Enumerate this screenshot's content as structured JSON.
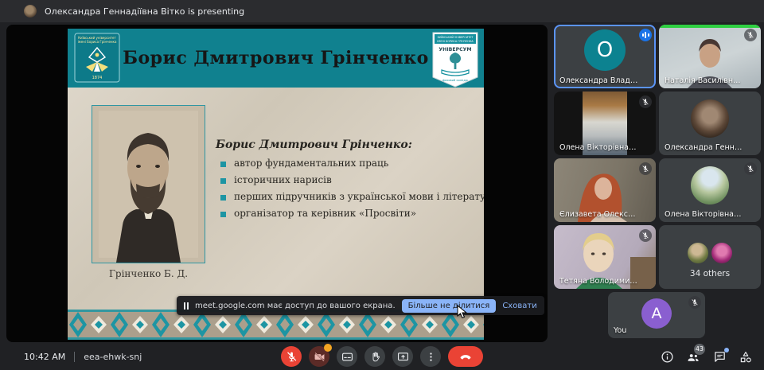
{
  "top_bar": {
    "presenting_text": "Олександра Геннадіївна Вітко is presenting"
  },
  "slide": {
    "title": "Борис Дмитрович Грінченко",
    "intro_heading": "Борис Дмитрович Грінченко:",
    "bullets": [
      "автор фундаментальних праць",
      "історичних нарисів",
      "перших підручників з української мови і літератури",
      "організатор та керівник «Просвіти»"
    ],
    "portrait_caption": "Грінченко Б. Д.",
    "left_logo": {
      "line1": "Київський університет",
      "line2": "імені Бориса Грінченка",
      "year": "1874"
    },
    "right_logo": {
      "line1": "КИЇВСЬКИЙ УНІВЕРСИТЕТ",
      "line2": "ІМЕНІ БОРИСА ГРІНЧЕНКА",
      "name": "УНІВЕРСУМ",
      "subtitle": "фаховий коледж"
    }
  },
  "share_notice": {
    "text": "meet.google.com має доступ до вашого екрана.",
    "stop_sharing_label": "Більше не ділитися",
    "hide_label": "Сховати"
  },
  "participants": [
    {
      "name": "Олександра Владиславівна ...",
      "initial": "О"
    },
    {
      "name": "Наталія Василівна Розінкович"
    },
    {
      "name": "Олена Вікторівна Груздьова"
    },
    {
      "name": "Олександра Геннадіївна Вітко"
    },
    {
      "name": "Єлизавета Олександрівна Мі..."
    },
    {
      "name": "Олена Вікторівна Груздьова"
    },
    {
      "name": "Тетяна Володимирівна Ловей..."
    },
    {
      "name": "34 others"
    },
    {
      "name": "You",
      "initial": "A"
    }
  ],
  "bottom_bar": {
    "time": "10:42 AM",
    "meeting_code": "eea-ehwk-snj",
    "participants_count": "43"
  },
  "colors": {
    "teal_header": "#10818f",
    "accent_blue": "#8ab4f8",
    "control_red": "#ea4335",
    "speaking_border": "#5b94f7"
  }
}
